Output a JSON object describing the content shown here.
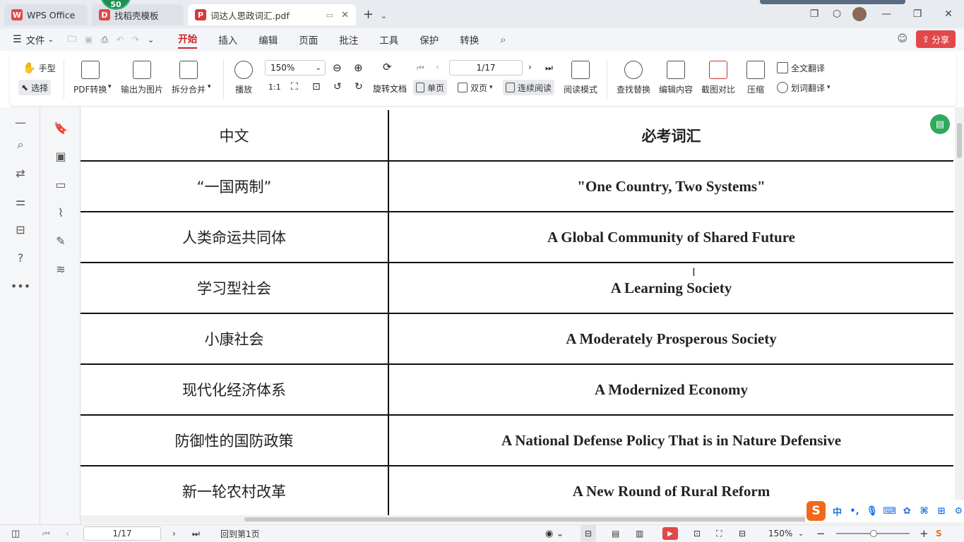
{
  "tabs": {
    "wps": "WPS Office",
    "template": "找稻壳模板",
    "pdf": "词达人思政词汇.pdf",
    "badge": "50"
  },
  "menu": [
    "文件",
    "开始",
    "插入",
    "编辑",
    "页面",
    "批注",
    "工具",
    "保护",
    "转换"
  ],
  "share_label": "分享",
  "ribbon": {
    "hand": "手型",
    "select": "选择",
    "pdf_convert": "PDF转换",
    "export_image": "输出为图片",
    "split_merge": "拆分合并",
    "play": "播放",
    "zoom": "150%",
    "page": "1/17",
    "rotate_doc": "旋转文档",
    "single_page": "单页",
    "double_page": "双页",
    "continuous": "连续阅读",
    "reading_mode": "阅读模式",
    "find_replace": "查找替换",
    "edit_content": "编辑内容",
    "screenshot_compare": "截图对比",
    "compress": "压缩",
    "full_translate": "全文翻译",
    "word_translate": "划词翻译"
  },
  "table": {
    "header": {
      "zh": "中文",
      "en": "必考词汇"
    },
    "rows": [
      {
        "zh": "“一国两制”",
        "en": "\"One Country, Two Systems\""
      },
      {
        "zh": "人类命运共同体",
        "en": "A Global Community of Shared Future"
      },
      {
        "zh": "学习型社会",
        "en": "A Learning Society"
      },
      {
        "zh": "小康社会",
        "en": "A Moderately Prosperous Society"
      },
      {
        "zh": "现代化经济体系",
        "en": "A Modernized Economy"
      },
      {
        "zh": "防御性的国防政策",
        "en": "A National Defense Policy That is in Nature Defensive"
      },
      {
        "zh": "新一轮农村改革",
        "en": "A New Round of Rural Reform"
      }
    ]
  },
  "status": {
    "page": "1/17",
    "back_to_first": "回到第1页",
    "zoom": "150%"
  },
  "ime": {
    "lang": "中"
  },
  "colors": {
    "accent": "#c8272a",
    "share": "#e2484a",
    "green": "#2eaa5c"
  }
}
